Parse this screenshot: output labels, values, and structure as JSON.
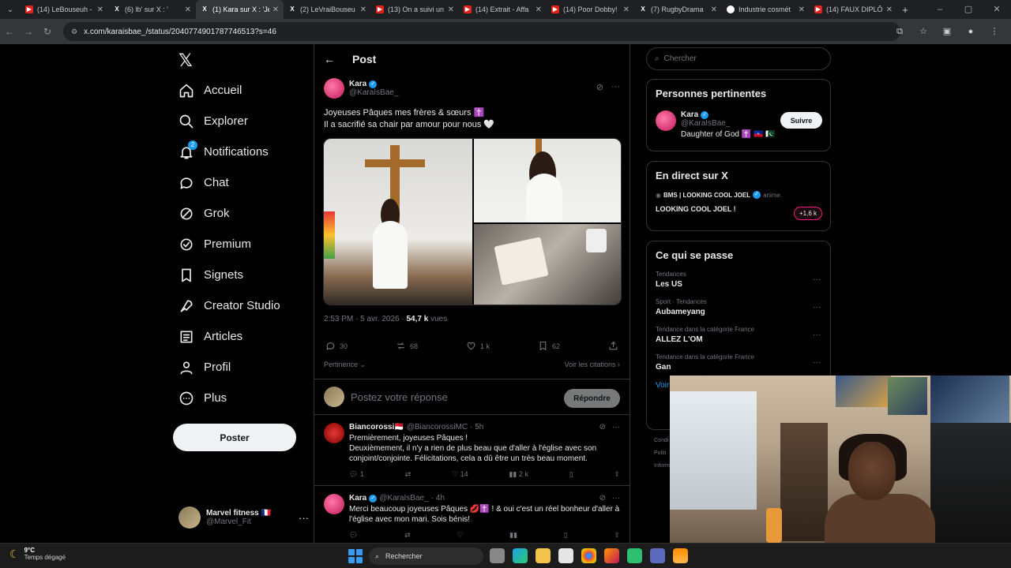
{
  "browser": {
    "tabs": [
      {
        "label": "(14) LeBouseuh -",
        "icon": "youtube-icon",
        "active": false
      },
      {
        "label": "(6) lb' sur X : '",
        "icon": "x-icon",
        "active": false
      },
      {
        "label": "(1) Kara sur X : 'Je",
        "icon": "x-icon",
        "active": true
      },
      {
        "label": "(2) LeVraiBouseu",
        "icon": "x-icon",
        "active": false
      },
      {
        "label": "(13) On a suivi un",
        "icon": "youtube-icon",
        "active": false
      },
      {
        "label": "(14) Extrait - Affa",
        "icon": "youtube-icon",
        "active": false
      },
      {
        "label": "(14) Poor Dobby!",
        "icon": "youtube-icon",
        "active": false
      },
      {
        "label": "(7) RugbyDrama",
        "icon": "x-icon",
        "active": false
      },
      {
        "label": "Industrie cosmét",
        "icon": "google-icon",
        "active": false
      },
      {
        "label": "(14) FAUX DIPLÔ",
        "icon": "youtube-icon",
        "active": false
      }
    ],
    "url": "x.com/karaisbae_/status/2040774901787746513?s=46"
  },
  "nav": {
    "items": [
      {
        "label": "Accueil",
        "icon": "home-icon"
      },
      {
        "label": "Explorer",
        "icon": "search-icon"
      },
      {
        "label": "Notifications",
        "icon": "bell-icon",
        "badge": "2"
      },
      {
        "label": "Chat",
        "icon": "chat-icon"
      },
      {
        "label": "Grok",
        "icon": "grok-icon"
      },
      {
        "label": "Premium",
        "icon": "premium-icon"
      },
      {
        "label": "Signets",
        "icon": "bookmark-icon"
      },
      {
        "label": "Creator Studio",
        "icon": "rocket-icon"
      },
      {
        "label": "Articles",
        "icon": "article-icon"
      },
      {
        "label": "Profil",
        "icon": "user-icon"
      },
      {
        "label": "Plus",
        "icon": "more-circle-icon"
      }
    ],
    "post_button": "Poster",
    "account": {
      "name": "Marvel fitness 🇫🇷",
      "handle": "@Marvel_Fit"
    }
  },
  "post": {
    "header_title": "Post",
    "author": "Kara",
    "handle": "@KaraIsBae_",
    "text_line1": "Joyeuses Pâques mes frères & sœurs ✝️",
    "text_line2": "Il a sacrifié sa chair par amour pour nous 🤍",
    "time": "2:53 PM · 5 avr. 2026 · ",
    "views_count": "54,7 k",
    "views_label": " vues",
    "stats": {
      "replies": "30",
      "reposts": "68",
      "likes": "1 k",
      "bookmarks": "62"
    },
    "sort_label": "Pertinence ⌄",
    "quotes_label": "Voir les citations ›",
    "reply_placeholder": "Postez votre réponse",
    "reply_button": "Répondre"
  },
  "comments": [
    {
      "name": "Biancorossi🇲🇨",
      "handle": "@BiancorossiMC",
      "time": "· 5h",
      "lines": [
        "Premièrement, joyeuses Pâques !",
        "Deuxièmement, il n'y a rien de plus beau que d'aller à l'église avec son conjoint/conjointe. Félicitations, cela a dû être un très beau moment."
      ],
      "replies": "1",
      "reposts": "",
      "likes": "14",
      "views": "2 k"
    },
    {
      "name": "Kara",
      "handle": "@KaraIsBae_",
      "time": "· 4h",
      "lines": [
        "Merci beaucoup joyeuses Pâques 💋✝️ ! & oui c'est un réel bonheur d'aller à l'église avec mon mari. Sois bénis!"
      ],
      "replies": "",
      "reposts": "",
      "likes": "",
      "views": ""
    }
  ],
  "sidebar": {
    "search_placeholder": "Chercher",
    "relevant_title": "Personnes pertinentes",
    "relevant": {
      "name": "Kara",
      "handle": "@KaraIsBae_",
      "bio": "Daughter of God ✝️ 🇭🇹 🇵🇰",
      "button": "Suivre"
    },
    "live_title": "En direct sur X",
    "live": {
      "host": "BMS | LOOKING COOL JOEL",
      "role": "anime.",
      "title": "LOOKING COOL JOEL !",
      "count": "+1,6 k"
    },
    "trends_title": "Ce qui se passe",
    "trends": [
      {
        "meta": "Tendances",
        "name": "Les US"
      },
      {
        "meta": "Sport · Tendances",
        "name": "Aubameyang"
      },
      {
        "meta": "Tendance dans la catégorie France",
        "name": "ALLEZ L'OM"
      },
      {
        "meta": "Tendance dans la catégorie France",
        "name": "Gan"
      }
    ],
    "show_more": "Voir",
    "footer": [
      "Condi",
      "Politi",
      "Inform"
    ]
  },
  "taskbar": {
    "temperature": "9°C",
    "weather": "Temps dégagé",
    "search": "Rechercher"
  },
  "colors": {
    "accent": "#1d9bf0",
    "background": "#000000",
    "border": "#2f3336",
    "muted": "#71767b"
  }
}
